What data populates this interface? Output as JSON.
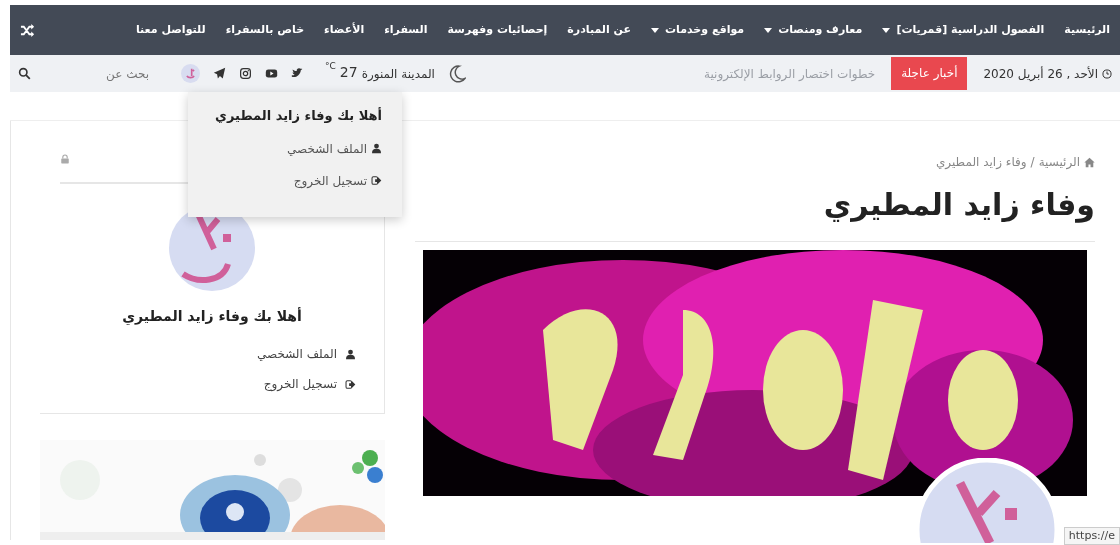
{
  "nav": {
    "items": [
      {
        "label": "الرئيسية",
        "dropdown": false
      },
      {
        "label": "الفصول الدراسية [قمريات]",
        "dropdown": true
      },
      {
        "label": "معارف ومنصات",
        "dropdown": true
      },
      {
        "label": "مواقع وخدمات",
        "dropdown": true
      },
      {
        "label": "عن المبادرة",
        "dropdown": false
      },
      {
        "label": "إحصائيات وفهرسة",
        "dropdown": false
      },
      {
        "label": "السفراء",
        "dropdown": false
      },
      {
        "label": "الأعضاء",
        "dropdown": false
      },
      {
        "label": "خاص بالسفراء",
        "dropdown": false
      },
      {
        "label": "للتواصل معنا",
        "dropdown": false
      }
    ]
  },
  "topbar": {
    "date": "الأحد , 26 أبريل 2020",
    "breaking_label": "أخبار عاجلة",
    "ticker": "خطوات اختصار الروابط الإلكترونية",
    "weather": {
      "city": "المدينة المنورة",
      "temp": "27",
      "unit": "°C"
    },
    "search": {
      "placeholder": "بحث عن"
    }
  },
  "user_menu": {
    "greeting": "أهلا بك وفاء زايد المطيري",
    "items": [
      {
        "label": "الملف الشخصي",
        "kind": "profile"
      },
      {
        "label": "تسجيل الخروج",
        "kind": "logout"
      }
    ]
  },
  "breadcrumb": [
    {
      "label": "الرئيسية",
      "kind": "home"
    },
    {
      "label": "/",
      "kind": "separator"
    },
    {
      "label": "وفاء زايد المطيري",
      "kind": "current"
    }
  ],
  "title": "وفاء زايد المطيري",
  "sidebar": {
    "greeting": "أهلا بك وفاء زايد المطيري",
    "items": [
      {
        "label": "الملف الشخصي",
        "kind": "profile"
      },
      {
        "label": "تسجيل الخروج",
        "kind": "logout"
      }
    ]
  },
  "status_link": "https://e"
}
